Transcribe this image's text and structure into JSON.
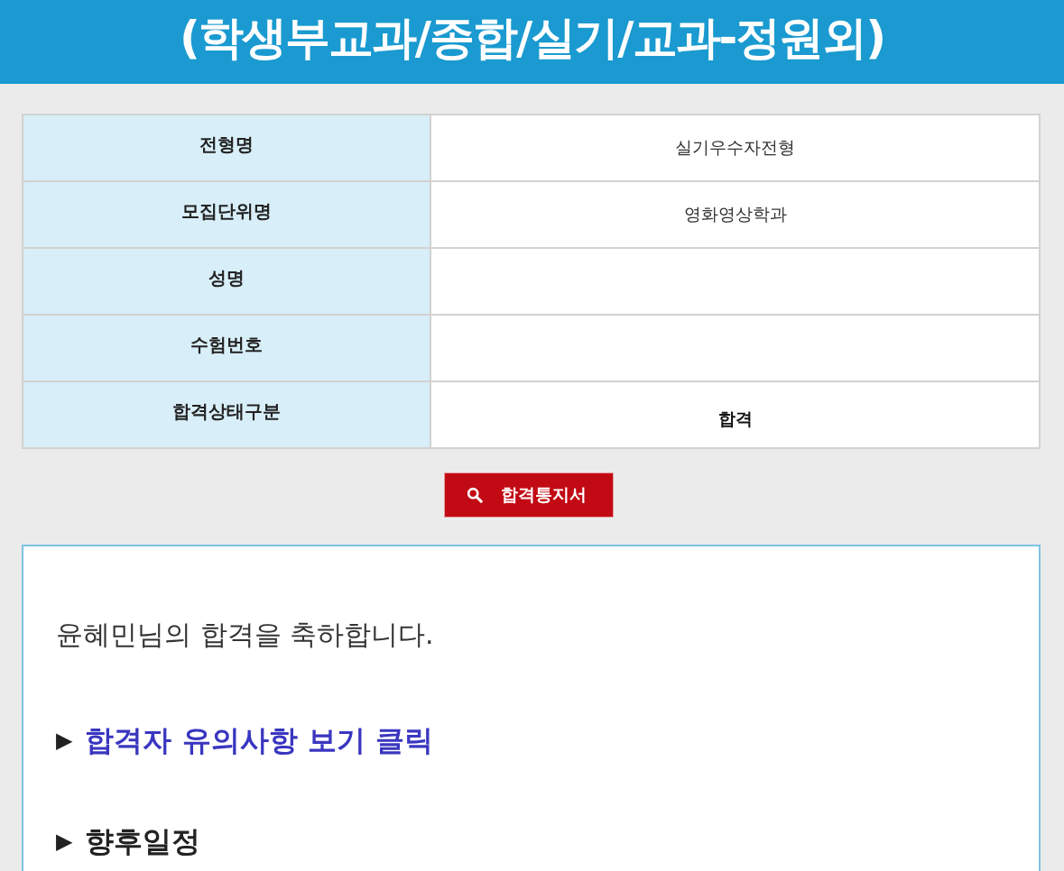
{
  "header": {
    "title": "(학생부교과/종합/실기/교과-정원외)"
  },
  "info_table": {
    "rows": [
      {
        "label": "전형명",
        "value": "실기우수자전형",
        "kind": "text"
      },
      {
        "label": "모집단위명",
        "value": "영화영상학과",
        "kind": "text"
      },
      {
        "label": "성명",
        "kind": "text"
      },
      {
        "label": "수험번호",
        "kind": "text"
      },
      {
        "label": "합격상태구분",
        "value": "합격",
        "kind": "status"
      }
    ]
  },
  "notice_button": {
    "label": "합격통지서"
  },
  "message_box": {
    "greeting": "윤혜민님의 합격을 축하합니다.",
    "items": [
      {
        "marker": "▶",
        "label": "합격자 유의사항 보기 클릭",
        "kind": "link"
      },
      {
        "marker": "▶",
        "label": "향후일정",
        "kind": "heading"
      }
    ]
  }
}
